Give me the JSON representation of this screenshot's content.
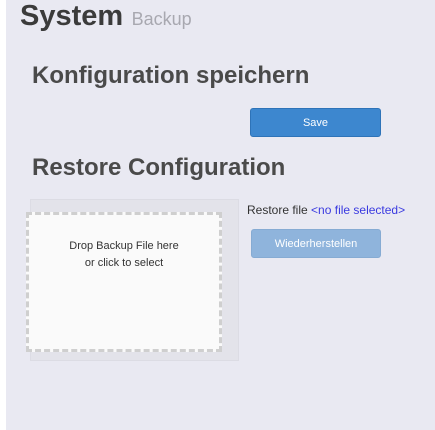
{
  "page": {
    "title": "System",
    "subtitle": "Backup"
  },
  "save_section": {
    "heading": "Konfiguration speichern",
    "button_label": "Save"
  },
  "restore_section": {
    "heading": "Restore Configuration",
    "dropzone": {
      "line1": "Drop Backup File here",
      "line2": "or click to select"
    },
    "file_label": "Restore file",
    "file_value": "<no file selected>",
    "button_label": "Wiederherstellen"
  }
}
